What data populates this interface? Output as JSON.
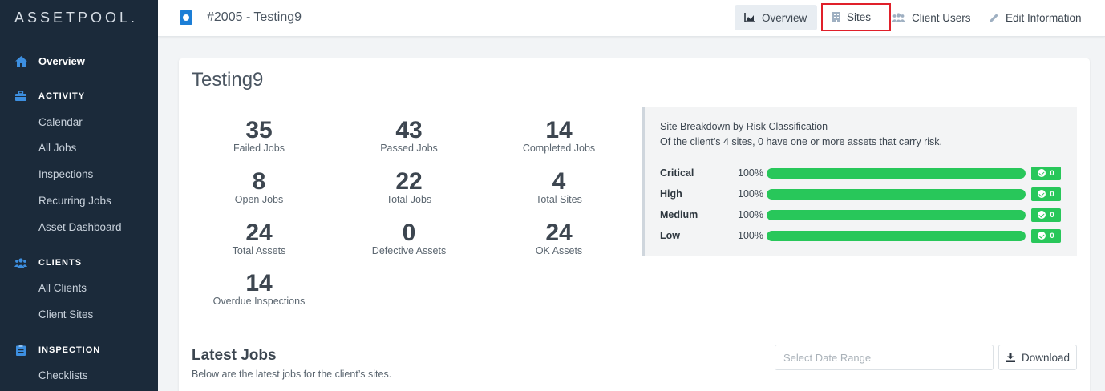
{
  "brand": {
    "logo_text": "ASSETPOOL."
  },
  "sidebar": {
    "top_item": {
      "label": "Overview",
      "icon": "home-icon"
    },
    "sections": [
      {
        "title": "ACTIVITY",
        "icon": "briefcase-icon",
        "items": [
          "Calendar",
          "All Jobs",
          "Inspections",
          "Recurring Jobs",
          "Asset Dashboard"
        ]
      },
      {
        "title": "CLIENTS",
        "icon": "users-icon",
        "items": [
          "All Clients",
          "Client Sites"
        ]
      },
      {
        "title": "INSPECTION",
        "icon": "clipboard-icon",
        "items": [
          "Checklists"
        ]
      }
    ]
  },
  "header": {
    "title": "#2005 - Testing9",
    "tabs": [
      {
        "label": "Overview",
        "icon": "chart-area-icon"
      },
      {
        "label": "Sites",
        "icon": "building-icon"
      },
      {
        "label": "Client Users",
        "icon": "users-icon"
      },
      {
        "label": "Edit Information",
        "icon": "pencil-icon"
      }
    ]
  },
  "card": {
    "title": "Testing9",
    "stats": [
      {
        "value": "35",
        "label": "Failed Jobs"
      },
      {
        "value": "43",
        "label": "Passed Jobs"
      },
      {
        "value": "14",
        "label": "Completed Jobs"
      },
      {
        "value": "8",
        "label": "Open Jobs"
      },
      {
        "value": "22",
        "label": "Total Jobs"
      },
      {
        "value": "4",
        "label": "Total Sites"
      },
      {
        "value": "24",
        "label": "Total Assets"
      },
      {
        "value": "0",
        "label": "Defective Assets"
      },
      {
        "value": "24",
        "label": "OK Assets"
      },
      {
        "value": "14",
        "label": "Overdue Inspections"
      }
    ]
  },
  "risk": {
    "heading": "Site Breakdown by Risk Classification",
    "summary": "Of the client’s 4 sites, 0 have one or more assets that carry risk.",
    "rows": [
      {
        "name": "Critical",
        "percent_text": "100%",
        "fill": 1.0,
        "count": "0"
      },
      {
        "name": "High",
        "percent_text": "100%",
        "fill": 1.0,
        "count": "0"
      },
      {
        "name": "Medium",
        "percent_text": "100%",
        "fill": 1.0,
        "count": "0"
      },
      {
        "name": "Low",
        "percent_text": "100%",
        "fill": 1.0,
        "count": "0"
      }
    ],
    "bar_color": "#28c75a"
  },
  "latest": {
    "title": "Latest Jobs",
    "subtitle": "Below are the latest jobs for the client’s sites.",
    "date_placeholder": "Select Date Range",
    "download_label": "Download"
  },
  "colors": {
    "sidebar_bg": "#1b2a3a",
    "accent": "#1c7ed6",
    "highlight_border": "#e0202a"
  }
}
